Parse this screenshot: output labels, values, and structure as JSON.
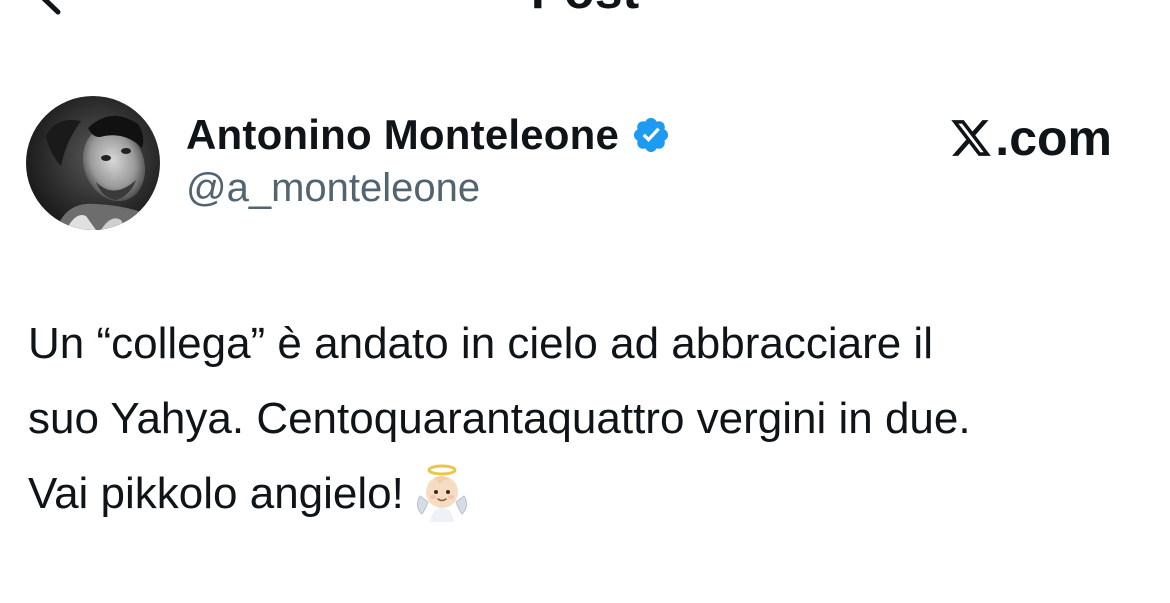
{
  "header": {
    "title": "Post",
    "back_icon": "chevron-left-icon"
  },
  "author": {
    "name": "Antonino Monteleone",
    "handle": "@a_monteleone",
    "verified": true,
    "verified_color": "#1d9bf0",
    "avatar_icon": "profile-photo"
  },
  "source": {
    "logo_icon": "x-logo-icon",
    "domain": ".com"
  },
  "post": {
    "lines": [
      "Un “collega” è andato in cielo ad abbracciare il",
      "suo Yahya. Centoquarantaquattro vergini in due.",
      "Vai pikkolo angielo!"
    ],
    "emoji": "baby-angel-emoji"
  },
  "colors": {
    "text": "#0f1419",
    "secondary_text": "#536471",
    "background": "#ffffff",
    "accent": "#1d9bf0"
  }
}
